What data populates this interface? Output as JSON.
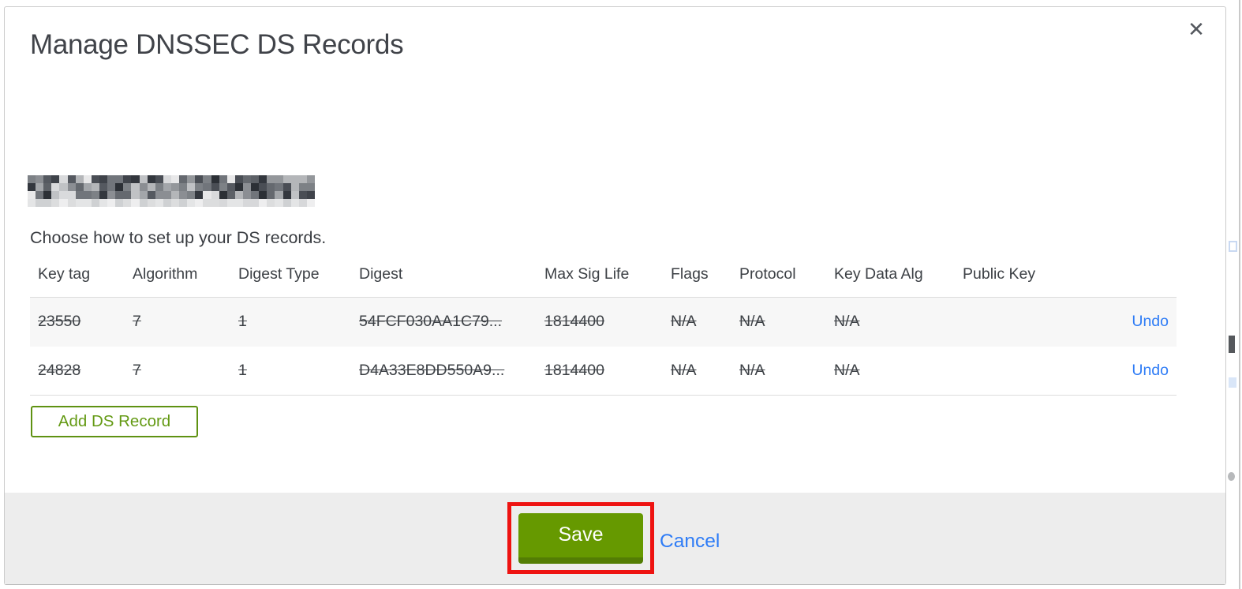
{
  "modal": {
    "title": "Manage DNSSEC DS Records",
    "close_label": "✕",
    "instruction": "Choose how to set up your DS records.",
    "table": {
      "columns": [
        "Key tag",
        "Algorithm",
        "Digest Type",
        "Digest",
        "Max Sig Life",
        "Flags",
        "Protocol",
        "Key Data Alg",
        "Public Key"
      ],
      "rows": [
        {
          "key_tag": "23550",
          "algorithm": "7",
          "digest_type": "1",
          "digest": "54FCF030AA1C79...",
          "max_sig_life": "1814400",
          "flags": "N/A",
          "protocol": "N/A",
          "key_data_alg": "N/A",
          "public_key": "",
          "action": "Undo",
          "state": "pending-delete"
        },
        {
          "key_tag": "24828",
          "algorithm": "7",
          "digest_type": "1",
          "digest": "D4A33E8DD550A9...",
          "max_sig_life": "1814400",
          "flags": "N/A",
          "protocol": "N/A",
          "key_data_alg": "N/A",
          "public_key": "",
          "action": "Undo",
          "state": "pending-delete"
        }
      ]
    },
    "add_button_label": "Add DS Record",
    "footer": {
      "save_label": "Save",
      "cancel_label": "Cancel"
    }
  },
  "colors": {
    "accent_green": "#669900",
    "accent_green_dark": "#537d04",
    "link_blue": "#2e7cf6",
    "annotation_red": "#ee1311",
    "footer_gray": "#ededed",
    "row_shaded": "#f7f7f7"
  }
}
